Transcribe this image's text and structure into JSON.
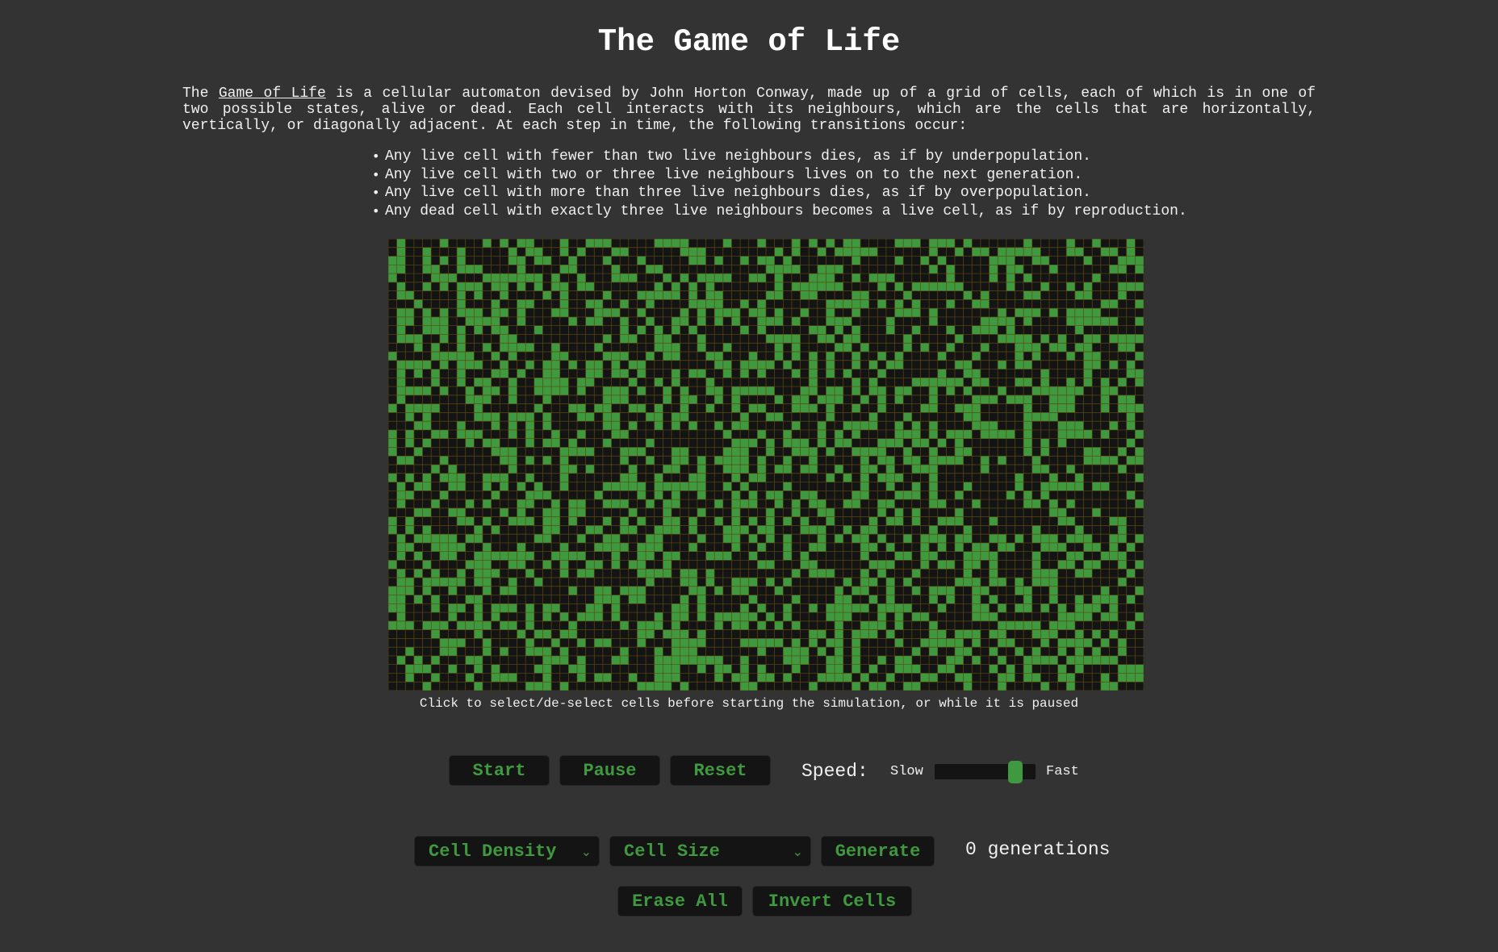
{
  "page": {
    "title": "The Game of Life"
  },
  "intro": {
    "prefix": "The ",
    "link_text": "Game of Life",
    "suffix": " is a cellular automaton devised by John Horton Conway, made up of a grid of cells, each of which is in one of two possible states, alive or dead. Each cell interacts with its neighbours, which are the cells that are horizontally, vertically, or diagonally adjacent. At each step in time, the following transitions occur:"
  },
  "rules": [
    "Any live cell with fewer than two live neighbours dies, as if by underpopulation.",
    "Any live cell with two or three live neighbours lives on to the next generation.",
    "Any live cell with more than three live neighbours dies, as if by overpopulation.",
    "Any dead cell with exactly three live neighbours becomes a live cell, as if by reproduction."
  ],
  "board": {
    "columns": 88,
    "rows": 52,
    "live_density": 0.4,
    "colors": {
      "live": "#3f9a3f",
      "dead": "#141414",
      "grid": "#5a4a10"
    }
  },
  "hint": "Click to select/de-select cells before starting the simulation, or while it is paused",
  "controls": {
    "start_label": "Start",
    "pause_label": "Pause",
    "reset_label": "Reset",
    "speed_label": "Speed:",
    "slow_label": "Slow",
    "fast_label": "Fast",
    "speed_value": 0.85,
    "cell_density_label": "Cell Density",
    "cell_size_label": "Cell Size",
    "generate_label": "Generate",
    "generations_text": "0 generations",
    "erase_all_label": "Erase All",
    "invert_cells_label": "Invert Cells"
  },
  "icons": {
    "dropdown": "chevron-down-icon"
  },
  "colors": {
    "background": "#333333",
    "accent": "#3f9a3f",
    "button_bg": "#141414"
  }
}
